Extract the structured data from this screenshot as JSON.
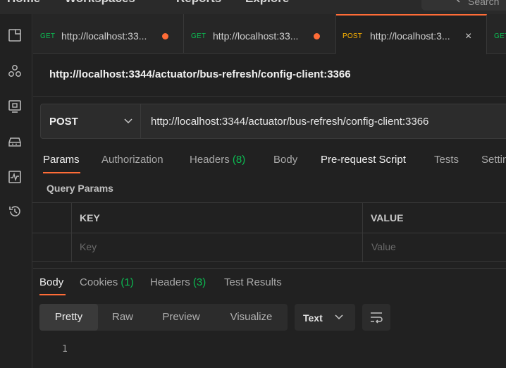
{
  "nav": {
    "home": "Home",
    "workspaces": "Workspaces",
    "reports": "Reports",
    "explore": "Explore",
    "search": "Search"
  },
  "sidebar": {
    "icons": [
      "collections-icon",
      "apis-icon",
      "environments-icon",
      "mock-servers-icon",
      "monitors-icon",
      "history-icon"
    ]
  },
  "tabs": [
    {
      "method": "GET",
      "url": "http://localhost:33...",
      "unsaved": true
    },
    {
      "method": "GET",
      "url": "http://localhost:33...",
      "unsaved": true
    },
    {
      "method": "POST",
      "url": "http://localhost:3...",
      "active": true
    },
    {
      "method": "GET",
      "url": ""
    }
  ],
  "request": {
    "title": "http://localhost:3344/actuator/bus-refresh/config-client:3366",
    "method": "POST",
    "url": "http://localhost:3344/actuator/bus-refresh/config-client:3366"
  },
  "request_tabs": {
    "params": "Params",
    "authorization": "Authorization",
    "headers": "Headers",
    "headers_count": "(8)",
    "body": "Body",
    "prerequest": "Pre-request Script",
    "tests": "Tests",
    "settings": "Settings"
  },
  "query_params": {
    "label": "Query Params",
    "columns": [
      "KEY",
      "VALUE"
    ],
    "placeholder_key": "Key",
    "placeholder_value": "Value"
  },
  "response": {
    "tabs": {
      "body": "Body",
      "cookies": "Cookies",
      "cookies_count": "(1)",
      "headers": "Headers",
      "headers_count": "(3)",
      "test_results": "Test Results"
    },
    "views": [
      "Pretty",
      "Raw",
      "Preview",
      "Visualize"
    ],
    "active_view": "Pretty",
    "format": "Text",
    "line_number": "1"
  },
  "colors": {
    "accent": "#ff6c37",
    "get": "#0cbb52",
    "post": "#ffb400"
  }
}
